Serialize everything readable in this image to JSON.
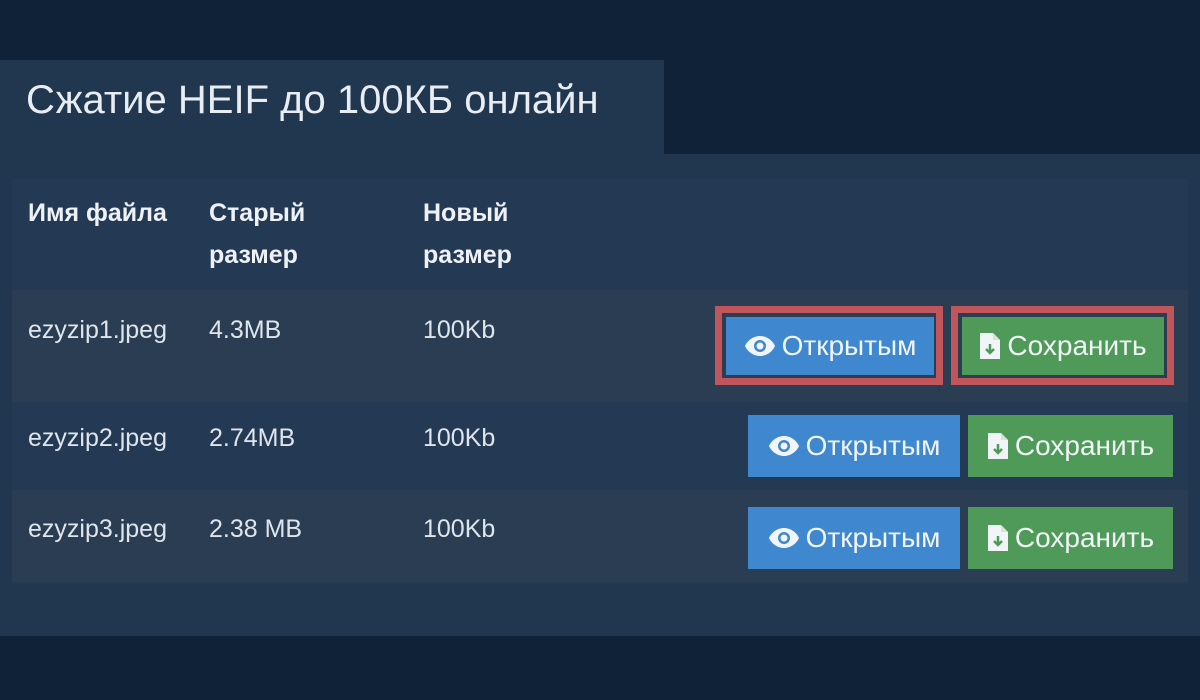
{
  "page": {
    "title": "Сжатие HEIF до 100КБ онлайн"
  },
  "table": {
    "headers": {
      "name": "Имя файла",
      "old_size": "Старый размер",
      "new_size": "Новый размер"
    },
    "rows": [
      {
        "name": "ezyzip1.jpeg",
        "old_size": "4.3MB",
        "new_size": "100Kb",
        "open_label": "Открытым",
        "save_label": "Сохранить",
        "highlighted": true
      },
      {
        "name": "ezyzip2.jpeg",
        "old_size": "2.74MB",
        "new_size": "100Kb",
        "open_label": "Открытым",
        "save_label": "Сохранить",
        "highlighted": false
      },
      {
        "name": "ezyzip3.jpeg",
        "old_size": "2.38 MB",
        "new_size": "100Kb",
        "open_label": "Открытым",
        "save_label": "Сохранить",
        "highlighted": false
      }
    ]
  },
  "icons": {
    "open": "eye-icon",
    "save": "file-download-icon"
  },
  "colors": {
    "background": "#0f2238",
    "panel": "#21364f",
    "open_button": "#3f87cf",
    "save_button": "#4f9a58",
    "highlight_border": "#c0555c"
  }
}
